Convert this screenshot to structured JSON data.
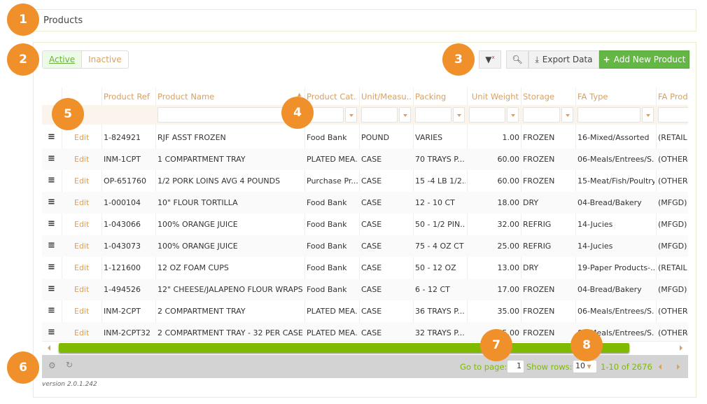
{
  "page_title": "Products",
  "status_toggle": {
    "active": "Active",
    "inactive": "Inactive"
  },
  "toolbar": {
    "clear_filter_icon": "filter-clear-icon",
    "search_icon": "search-icon",
    "export_label": "Export Data",
    "add_label": "Add New Product",
    "accent": "#64b744"
  },
  "columns": [
    "Product Ref",
    "Product Name",
    "Product Cat...",
    "Unit/Measu...",
    "Packing",
    "Unit Weight",
    "Storage",
    "FA Type",
    "FA Prod"
  ],
  "edit_label": "Edit",
  "rows": [
    [
      "1-824921",
      "RJF ASST FROZEN",
      "Food Bank",
      "POUND",
      "VARIES",
      "1.00",
      "FROZEN",
      "16-Mixed/Assorted",
      "(RETAIL"
    ],
    [
      "INM-1CPT",
      "1 COMPARTMENT TRAY",
      "PLATED MEA...",
      "CASE",
      "70 TRAYS P...",
      "60.00",
      "FROZEN",
      "06-Meals/Entrees/S...",
      "(OTHER-"
    ],
    [
      "OP-651760",
      "1/2 PORK LOINS AVG 4 POUNDS",
      "Purchase Pr...",
      "CASE",
      "15 -4 LB 1/2...",
      "60.00",
      "FROZEN",
      "15-Meat/Fish/Poultry",
      "(OTHER-"
    ],
    [
      "1-000104",
      "10\" FLOUR TORTILLA",
      "Food Bank",
      "CASE",
      "12 - 10 CT",
      "18.00",
      "DRY",
      "04-Bread/Bakery",
      "(MFGD)"
    ],
    [
      "1-043066",
      "100% ORANGE JUICE",
      "Food Bank",
      "CASE",
      "50 - 1/2 PIN...",
      "32.00",
      "REFRIG",
      "14-Jucies",
      "(MFGD)"
    ],
    [
      "1-043073",
      "100% ORANGE JUICE",
      "Food Bank",
      "CASE",
      "75 - 4 OZ CT",
      "25.00",
      "REFRIG",
      "14-Jucies",
      "(MFGD)"
    ],
    [
      "1-121600",
      "12 OZ FOAM CUPS",
      "Food Bank",
      "CASE",
      "50 - 12 OZ",
      "13.00",
      "DRY",
      "19-Paper Products-...",
      "(RETAIL"
    ],
    [
      "1-494526",
      "12\" CHEESE/JALAPENO FLOUR WRAPS",
      "Food Bank",
      "CASE",
      "6 - 12 CT",
      "17.00",
      "FROZEN",
      "04-Bread/Bakery",
      "(MFGD)"
    ],
    [
      "INM-2CPT",
      "2 COMPARTMENT TRAY",
      "PLATED MEA...",
      "CASE",
      "36 TRAYS P...",
      "35.00",
      "FROZEN",
      "06-Meals/Entrees/S...",
      "(OTHER-"
    ],
    [
      "INM-2CPT32",
      "2 COMPARTMENT TRAY - 32 PER CASE",
      "PLATED MEA...",
      "CASE",
      "32 TRAYS P...",
      "35.00",
      "FROZEN",
      "06-Meals/Entrees/S...",
      "(OTHER-"
    ]
  ],
  "footer": {
    "goto_label": "Go to page:",
    "page": "1",
    "show_rows_label": "Show rows:",
    "rows_per_page": "10",
    "range": "1-10 of 2676"
  },
  "version": "version 2.0.1.242",
  "annotations": [
    "1",
    "2",
    "3",
    "4",
    "5",
    "6",
    "7",
    "8"
  ]
}
